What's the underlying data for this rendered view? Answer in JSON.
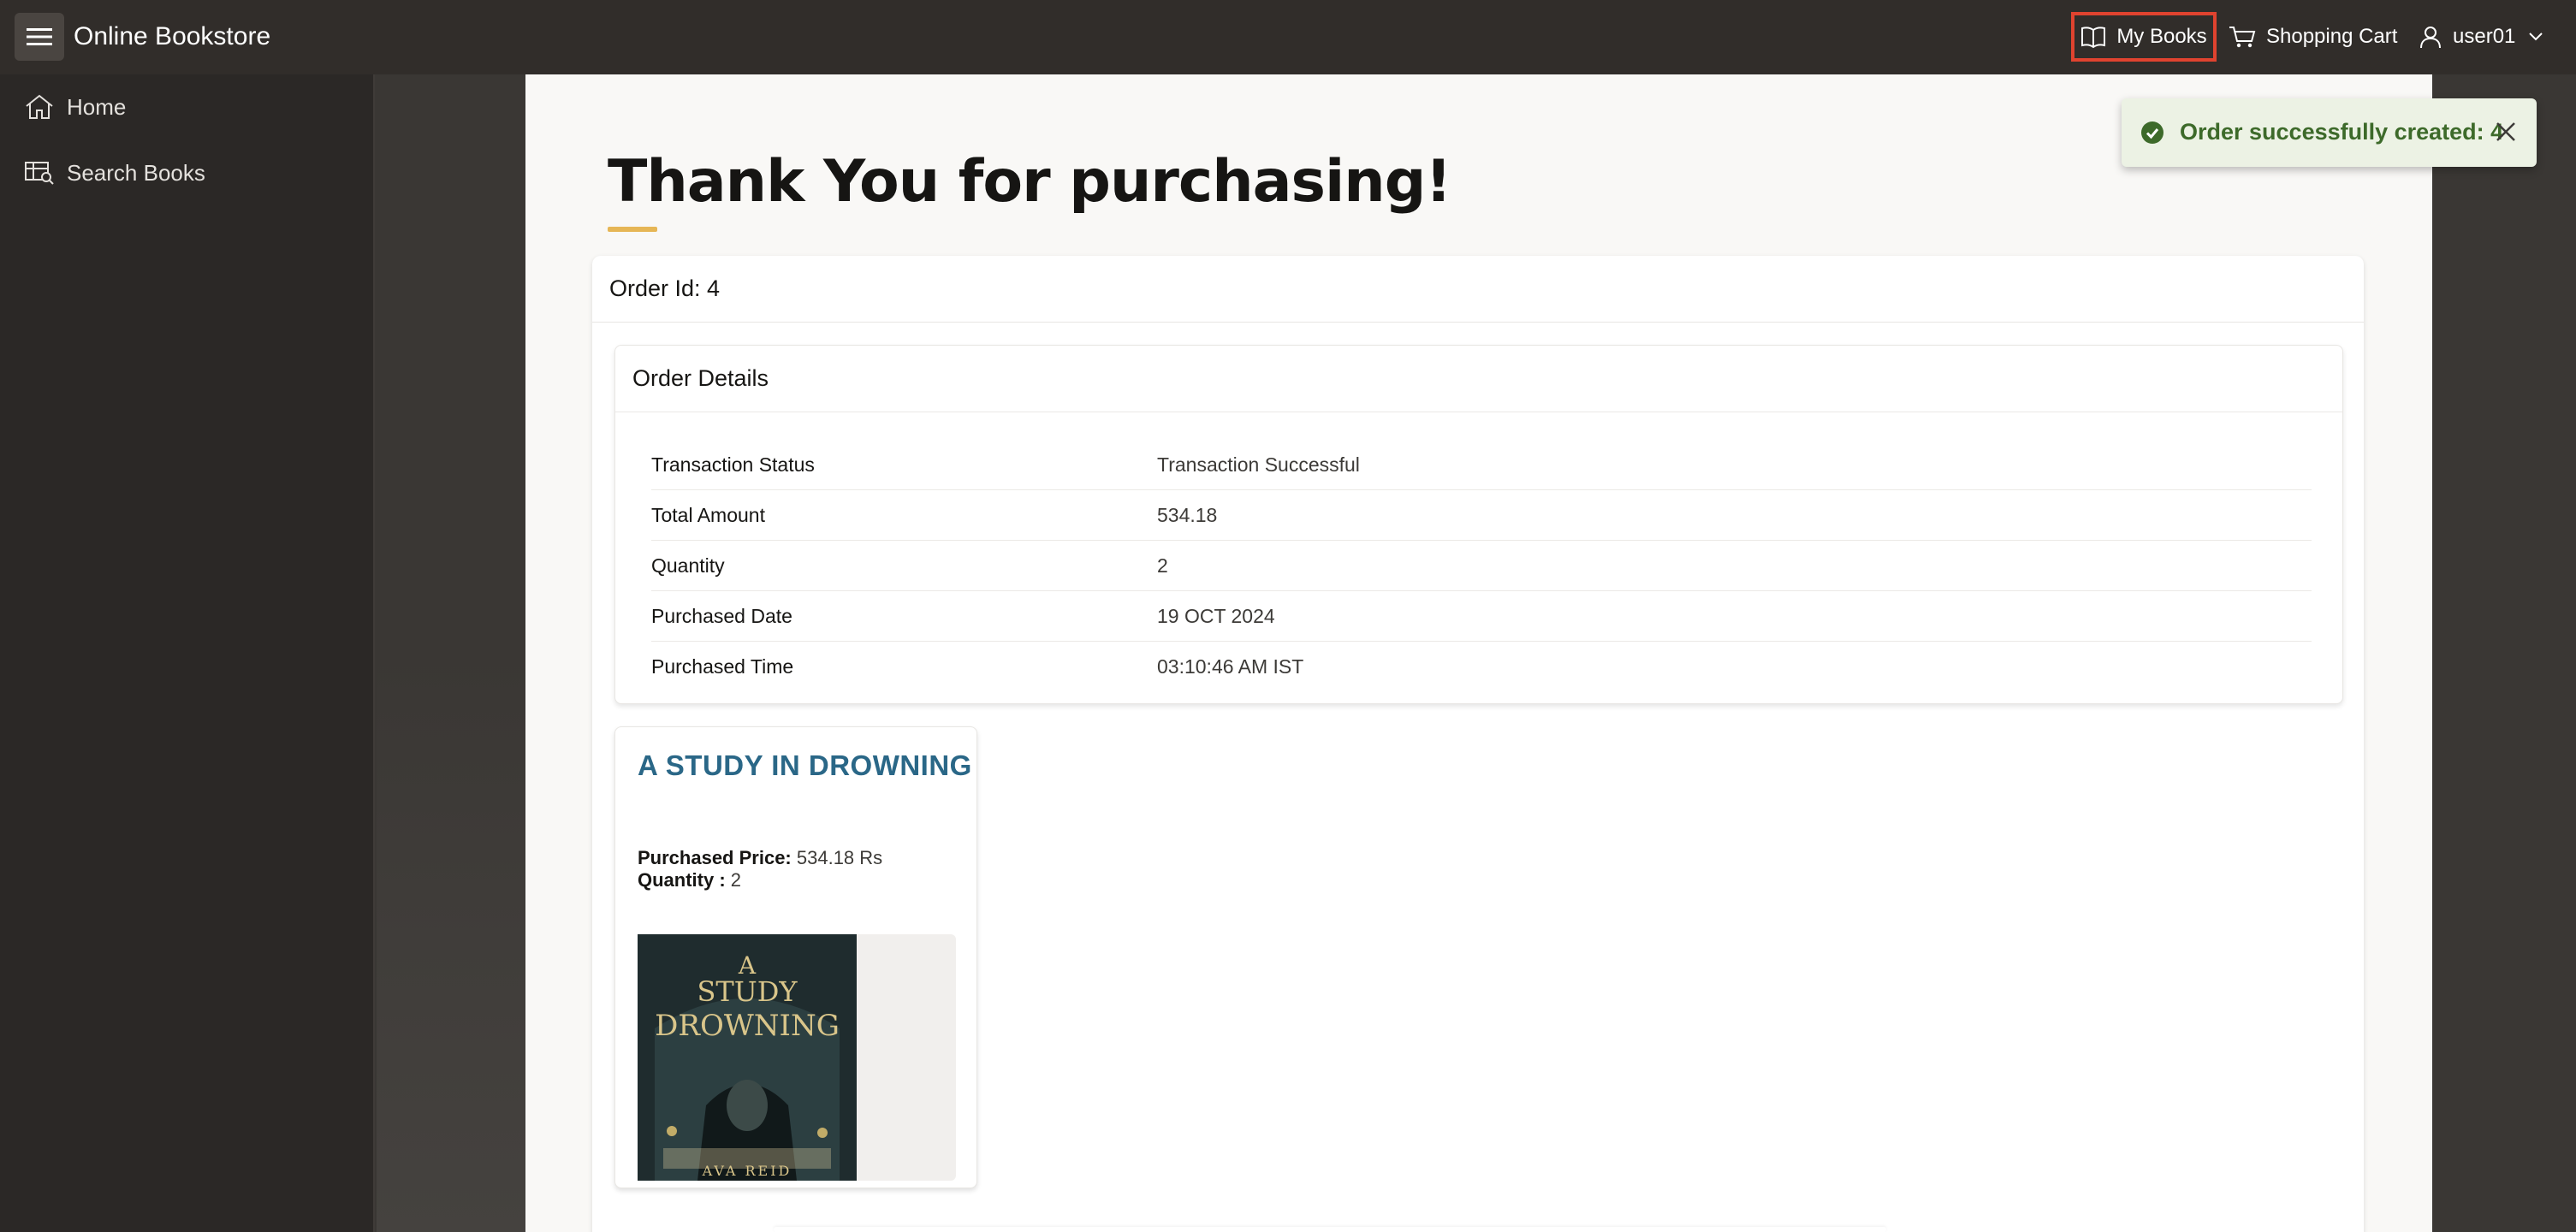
{
  "header": {
    "app_title": "Online Bookstore",
    "nav": {
      "my_books": "My Books",
      "shopping_cart": "Shopping Cart",
      "user": "user01"
    }
  },
  "sidebar": {
    "items": [
      {
        "label": "Home",
        "icon": "home-icon"
      },
      {
        "label": "Search Books",
        "icon": "search-books-icon"
      }
    ]
  },
  "main": {
    "page_title": "Thank You for purchasing!",
    "order_heading": "Order Id: 4",
    "details": {
      "heading": "Order Details",
      "rows": [
        {
          "label": "Transaction Status",
          "value": "Transaction Successful"
        },
        {
          "label": "Total Amount",
          "value": "534.18"
        },
        {
          "label": "Quantity",
          "value": "2"
        },
        {
          "label": "Purchased Date",
          "value": "19 OCT 2024"
        },
        {
          "label": "Purchased Time",
          "value": "03:10:46 AM IST"
        }
      ]
    },
    "book": {
      "title": "A STUDY IN DROWNING",
      "price_label": "Purchased Price:",
      "price_value": "534.18 Rs",
      "quantity_label": "Quantity :",
      "quantity_value": "2",
      "cover_title_1": "A",
      "cover_title_2": "STUDY",
      "cover_title_3": "DROWNING",
      "cover_author": "AVA REID"
    }
  },
  "toast": {
    "message": "Order successfully created: 4",
    "icon": "check-circle-icon"
  },
  "colors": {
    "header_bg": "#312d2a",
    "sidebar_bg": "#2b2826",
    "accent_underline": "#e6b655",
    "book_title": "#2a6787",
    "toast_bg": "#ecf2e4",
    "toast_text": "#3d6a2a",
    "highlight_border": "#e0432f"
  }
}
